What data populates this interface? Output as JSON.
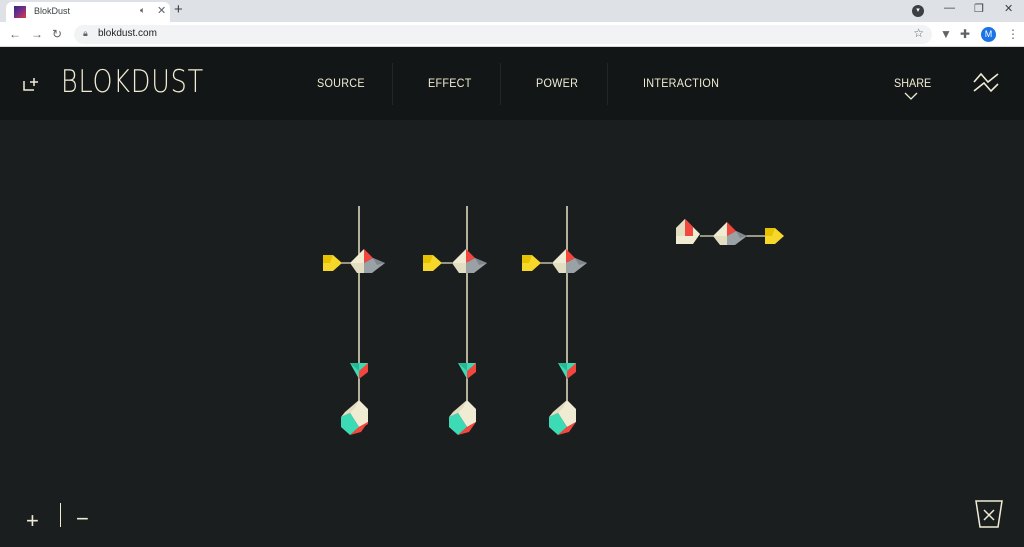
{
  "browser": {
    "tab_title": "BlokDust",
    "tab_audio_icon": "speaker-icon",
    "url": "blokdust.com",
    "profile_initial": "M"
  },
  "app": {
    "brand": "BLOKDUST",
    "menu": [
      "SOURCE",
      "EFFECT",
      "POWER",
      "INTERACTION"
    ],
    "share_label": "SHARE"
  },
  "colors": {
    "background": "#1b1e1f",
    "header": "#131617",
    "cream": "#f0ecd3",
    "red": "#f2473f",
    "teal": "#3ddbb5",
    "yellow": "#f7d82a",
    "grey": "#9ba2a6",
    "wire": "#e8e3c4"
  },
  "controls": {
    "zoom_in": "+",
    "zoom_out": "−"
  }
}
